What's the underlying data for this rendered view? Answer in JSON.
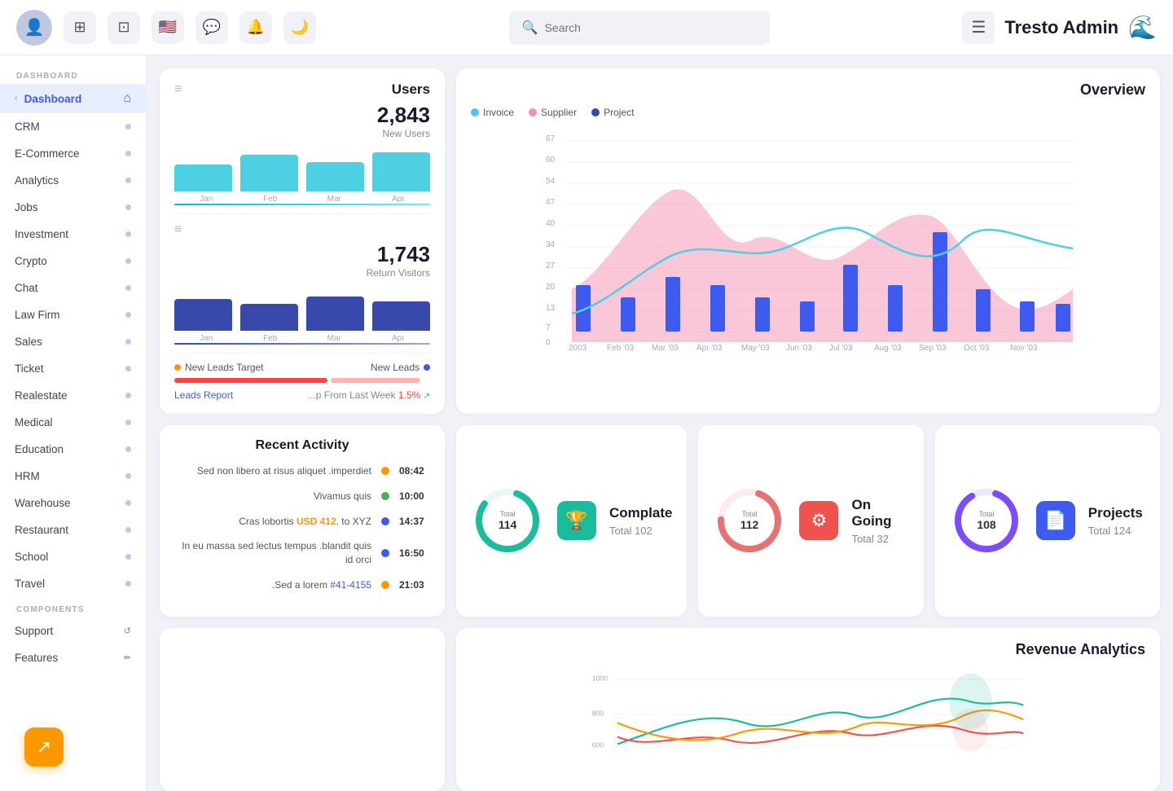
{
  "brand": {
    "title": "Tresto Admin",
    "icon": "🌊"
  },
  "topnav": {
    "search_placeholder": "Search",
    "icons": [
      "⊞",
      "⊡",
      "🇺🇸",
      "💬",
      "🔔",
      "🌙",
      "☰"
    ]
  },
  "sidebar": {
    "dashboard_label": "DASHBOARD",
    "components_label": "COMPONENTS",
    "active_item": "Dashboard",
    "items": [
      {
        "label": "Dashboard",
        "active": true
      },
      {
        "label": "CRM"
      },
      {
        "label": "E-Commerce"
      },
      {
        "label": "Analytics"
      },
      {
        "label": "Jobs"
      },
      {
        "label": "Investment"
      },
      {
        "label": "Crypto"
      },
      {
        "label": "Chat"
      },
      {
        "label": "Law Firm"
      },
      {
        "label": "Sales"
      },
      {
        "label": "Ticket"
      },
      {
        "label": "Realestate"
      },
      {
        "label": "Medical"
      },
      {
        "label": "Education"
      },
      {
        "label": "HRM"
      },
      {
        "label": "Warehouse"
      },
      {
        "label": "Restaurant"
      },
      {
        "label": "School"
      },
      {
        "label": "Travel"
      }
    ],
    "component_items": [
      {
        "label": "Support"
      },
      {
        "label": "Features"
      }
    ]
  },
  "users_card": {
    "title": "Users",
    "new_users_value": "2,843",
    "new_users_label": "New Users",
    "return_visitors_value": "1,743",
    "return_visitors_label": "Return Visitors",
    "months": [
      "Jan",
      "Feb",
      "Mar",
      "Apr"
    ],
    "new_users_bars": [
      55,
      75,
      60,
      80
    ],
    "return_visitors_bars": [
      65,
      55,
      70,
      60
    ]
  },
  "leads": {
    "new_leads_target": "New Leads Target",
    "new_leads": "New Leads",
    "leads_report": "Leads Report",
    "from_last_week": "...p From Last Week",
    "growth": "1.5%"
  },
  "overview": {
    "title": "Overview",
    "legend": [
      {
        "label": "Invoice",
        "color": "#4fc3f7"
      },
      {
        "label": "Supplier",
        "color": "#f48fb1"
      },
      {
        "label": "Project",
        "color": "#3949ab"
      }
    ],
    "x_labels": [
      "2003",
      "Feb '03",
      "Mar '03",
      "Apr '03",
      "May '03",
      "Jun '03",
      "Jul '03",
      "Aug '03",
      "Sep '03",
      "Oct '03",
      "Nov '03"
    ],
    "y_labels": [
      "67",
      "60",
      "54",
      "47",
      "40",
      "34",
      "27",
      "20",
      "13",
      "7",
      "0"
    ]
  },
  "activity": {
    "title": "Recent Activity",
    "items": [
      {
        "text": "Sed non libero at risus aliquet .imperdiet",
        "time": "08:42",
        "dot_color": "orange"
      },
      {
        "text": "Vivamus quis",
        "time": "10:00",
        "dot_color": "green"
      },
      {
        "text": "Cras lobortis USD 412. to XYZ",
        "time": "14:37",
        "dot_color": "blue",
        "link_text": "USD 412",
        "link_type": "orange"
      },
      {
        "text": "In eu massa sed lectus tempus .blandit quis id orci",
        "time": "16:50",
        "dot_color": "blue"
      },
      {
        "text": ".Sed a lorem #41-4155",
        "time": "21:03",
        "dot_color": "orange",
        "link_text": "#41-4155",
        "link_type": "blue"
      }
    ]
  },
  "stats": [
    {
      "donut_total": "Total",
      "donut_value": "114",
      "donut_color": "#1abc9c",
      "donut_bg": "#e8f8f5",
      "icon_bg": "#1abc9c",
      "icon": "🏆",
      "name": "Complate",
      "sub": "Total 102"
    },
    {
      "donut_total": "Total",
      "donut_value": "112",
      "donut_color": "#e57373",
      "donut_bg": "#ffebee",
      "icon_bg": "#ef5350",
      "icon": "⚙",
      "name": "On Going",
      "sub": "Total 32"
    },
    {
      "donut_total": "Total",
      "donut_value": "108",
      "donut_color": "#7c4dff",
      "donut_bg": "#ede7f6",
      "icon_bg": "#3d5af1",
      "icon": "📄",
      "name": "Projects",
      "sub": "Total 124"
    }
  ],
  "revenue": {
    "title": "Revenue Analytics",
    "y_labels": [
      "1000",
      "800",
      "600"
    ],
    "colors": [
      "#1abc9c",
      "#ef5350",
      "#3d5af1",
      "#ff9800"
    ]
  }
}
